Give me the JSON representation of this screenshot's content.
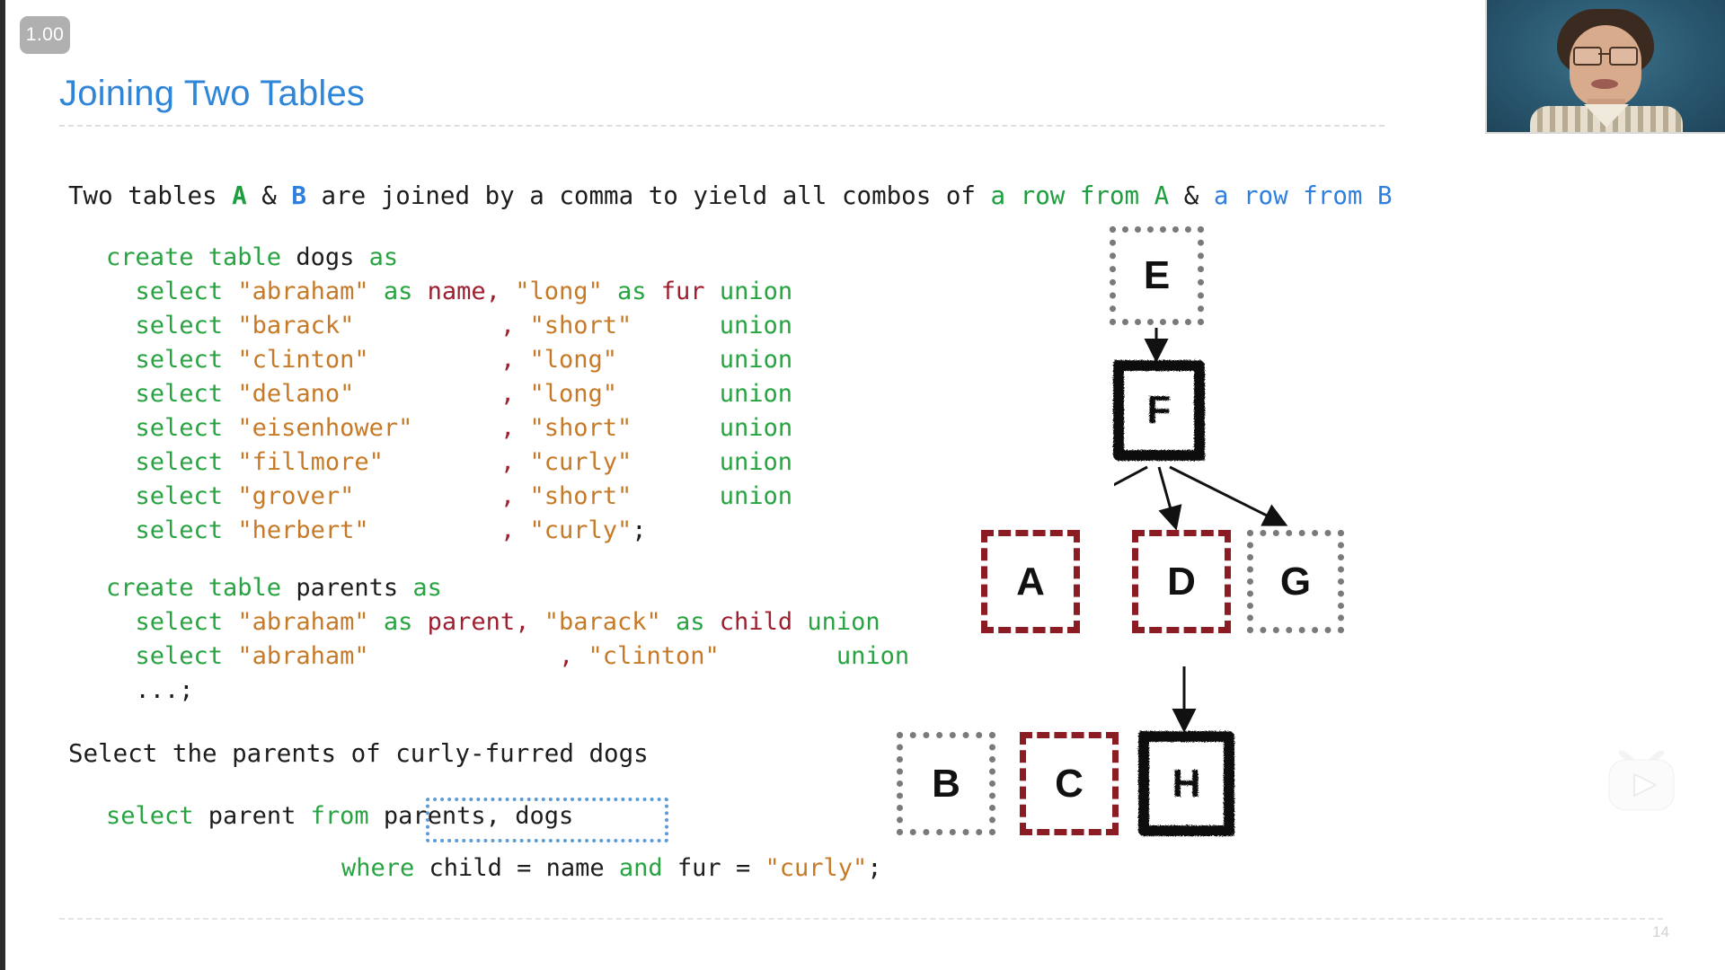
{
  "player": {
    "speed_badge": "1.00",
    "watermark_icon": "tv-play-icon"
  },
  "slide": {
    "title": "Joining Two Tables",
    "page_number": "14",
    "intro": {
      "seg1": "Two tables ",
      "tableA": "A",
      "seg2": " & ",
      "tableB": "B",
      "seg3": " are joined by a comma to yield all combos of ",
      "rowA": "a row from A",
      "seg4": " & ",
      "rowB": "a row from B"
    },
    "code_dogs": {
      "header_kw1": "create table ",
      "header_name": "dogs",
      "header_kw2": " as",
      "rows": [
        {
          "select": "select ",
          "name": "\"abraham\"",
          "as1": " as ",
          "col1": "name",
          "comma": ",",
          "fur": " \"long\"",
          "as2": " as ",
          "col2": "fur",
          "union": " union"
        },
        {
          "select": "select ",
          "name": "\"barack\"",
          "pad": "          ",
          "comma": ", ",
          "fur": "\"short\"",
          "padend": "      ",
          "union": "union"
        },
        {
          "select": "select ",
          "name": "\"clinton\"",
          "pad": "         ",
          "comma": ", ",
          "fur": "\"long\"",
          "padend": "       ",
          "union": "union"
        },
        {
          "select": "select ",
          "name": "\"delano\"",
          "pad": "          ",
          "comma": ", ",
          "fur": "\"long\"",
          "padend": "       ",
          "union": "union"
        },
        {
          "select": "select ",
          "name": "\"eisenhower\"",
          "pad": "      ",
          "comma": ", ",
          "fur": "\"short\"",
          "padend": "      ",
          "union": "union"
        },
        {
          "select": "select ",
          "name": "\"fillmore\"",
          "pad": "        ",
          "comma": ", ",
          "fur": "\"curly\"",
          "padend": "      ",
          "union": "union"
        },
        {
          "select": "select ",
          "name": "\"grover\"",
          "pad": "          ",
          "comma": ", ",
          "fur": "\"short\"",
          "padend": "      ",
          "union": "union"
        },
        {
          "select": "select ",
          "name": "\"herbert\"",
          "pad": "         ",
          "comma": ", ",
          "fur": "\"curly\"",
          "padend": "",
          "union": ";"
        }
      ]
    },
    "code_parents": {
      "header_kw1": "create table ",
      "header_name": "parents",
      "header_kw2": " as",
      "row1": {
        "select": "select ",
        "name": "\"abraham\"",
        "as1": " as ",
        "col1": "parent",
        "comma": ", ",
        "child": "\"barack\"",
        "as2": " as ",
        "col2": "child",
        "union": " union"
      },
      "row2": {
        "select": "select ",
        "name": "\"abraham\"",
        "pad": "             ",
        "comma": ", ",
        "child": "\"clinton\"",
        "padend": "        ",
        "union": "union"
      },
      "row3": "...;"
    },
    "prose": "Select the parents of curly-furred dogs",
    "query": {
      "select_kw": "select ",
      "col": "parent",
      "from_kw": " from ",
      "tables": "parents, dogs",
      "where_kw": "where ",
      "left_col": "child",
      "eq1": " = ",
      "right_col": "name",
      "and_kw": " and ",
      "fur_col": "fur",
      "eq2": " = ",
      "curly": "\"curly\"",
      "semi": ";"
    },
    "diagram": {
      "nodes": [
        {
          "id": "E",
          "label": "E",
          "style": "dotted"
        },
        {
          "id": "F",
          "label": "F",
          "style": "solid"
        },
        {
          "id": "A",
          "label": "A",
          "style": "dashed"
        },
        {
          "id": "D",
          "label": "D",
          "style": "dashed"
        },
        {
          "id": "G",
          "label": "G",
          "style": "dotted"
        },
        {
          "id": "B",
          "label": "B",
          "style": "dotted"
        },
        {
          "id": "C",
          "label": "C",
          "style": "dashed"
        },
        {
          "id": "H",
          "label": "H",
          "style": "solid"
        }
      ],
      "edges": [
        [
          "E",
          "F"
        ],
        [
          "F",
          "A"
        ],
        [
          "F",
          "D"
        ],
        [
          "F",
          "G"
        ],
        [
          "A",
          "B"
        ],
        [
          "A",
          "C"
        ],
        [
          "D",
          "H"
        ]
      ]
    }
  },
  "colors": {
    "title_blue": "#2f85d8",
    "keyword_green": "#28a341",
    "string_orange": "#c67a28",
    "column_red": "#9e1f2f",
    "highlight_blue": "#5b9bd5",
    "node_dashed_red": "#8c1c24",
    "node_dotted_gray": "#7a7a7a"
  }
}
